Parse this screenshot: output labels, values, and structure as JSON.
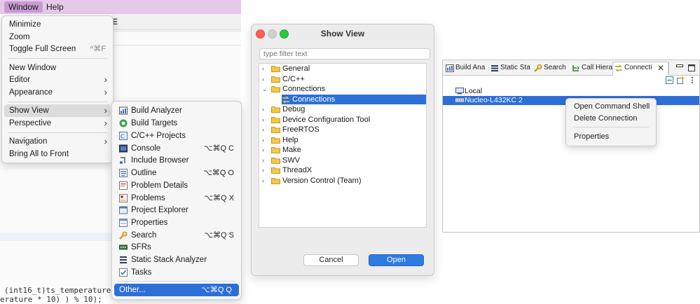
{
  "menubar": {
    "window": "Window",
    "help": "Help"
  },
  "editor": {
    "strip_char": "E",
    "code_line1": "(int16_t)ts_temperature,",
    "code_line2": "erature * 10) ) % 10);"
  },
  "window_menu": {
    "minimize": "Minimize",
    "zoom": "Zoom",
    "toggle_full_screen": "Toggle Full Screen",
    "toggle_full_screen_shortcut": "^⌘F",
    "new_window": "New Window",
    "editor": "Editor",
    "appearance": "Appearance",
    "show_view": "Show View",
    "perspective": "Perspective",
    "navigation": "Navigation",
    "bring_all_to_front": "Bring All to Front"
  },
  "show_view_menu": {
    "items": [
      {
        "label": "Build Analyzer",
        "shortcut": ""
      },
      {
        "label": "Build Targets",
        "shortcut": ""
      },
      {
        "label": "C/C++ Projects",
        "shortcut": ""
      },
      {
        "label": "Console",
        "shortcut": "⌥⌘Q C"
      },
      {
        "label": "Include Browser",
        "shortcut": ""
      },
      {
        "label": "Outline",
        "shortcut": "⌥⌘Q O"
      },
      {
        "label": "Problem Details",
        "shortcut": ""
      },
      {
        "label": "Problems",
        "shortcut": "⌥⌘Q X"
      },
      {
        "label": "Project Explorer",
        "shortcut": ""
      },
      {
        "label": "Properties",
        "shortcut": ""
      },
      {
        "label": "Search",
        "shortcut": "⌥⌘Q S"
      },
      {
        "label": "SFRs",
        "shortcut": ""
      },
      {
        "label": "Static Stack Analyzer",
        "shortcut": ""
      },
      {
        "label": "Tasks",
        "shortcut": ""
      }
    ],
    "other": {
      "label": "Other...",
      "shortcut": "⌥⌘Q Q"
    }
  },
  "show_view_dialog": {
    "title": "Show View",
    "filter_placeholder": "type filter text",
    "tree": [
      "General",
      "C/C++",
      "Connections",
      "Connections",
      "Debug",
      "Device Configuration Tool",
      "FreeRTOS",
      "Help",
      "Make",
      "SWV",
      "ThreadX",
      "Version Control (Team)"
    ],
    "cancel": "Cancel",
    "open": "Open"
  },
  "connections_view": {
    "tabs": [
      "Build Ana",
      "Static Sta",
      "Search",
      "Call Hiera",
      "Connecti"
    ],
    "close_glyph": "✕",
    "nodes": [
      "Local",
      "Nucleo-L432KC 2"
    ],
    "context_menu": [
      "Open Command Shell",
      "Delete Connection",
      "Properties"
    ]
  },
  "colors": {
    "menubar": "#e6c8ea",
    "selection": "#2d6fd6",
    "folder": "#e9b949"
  }
}
